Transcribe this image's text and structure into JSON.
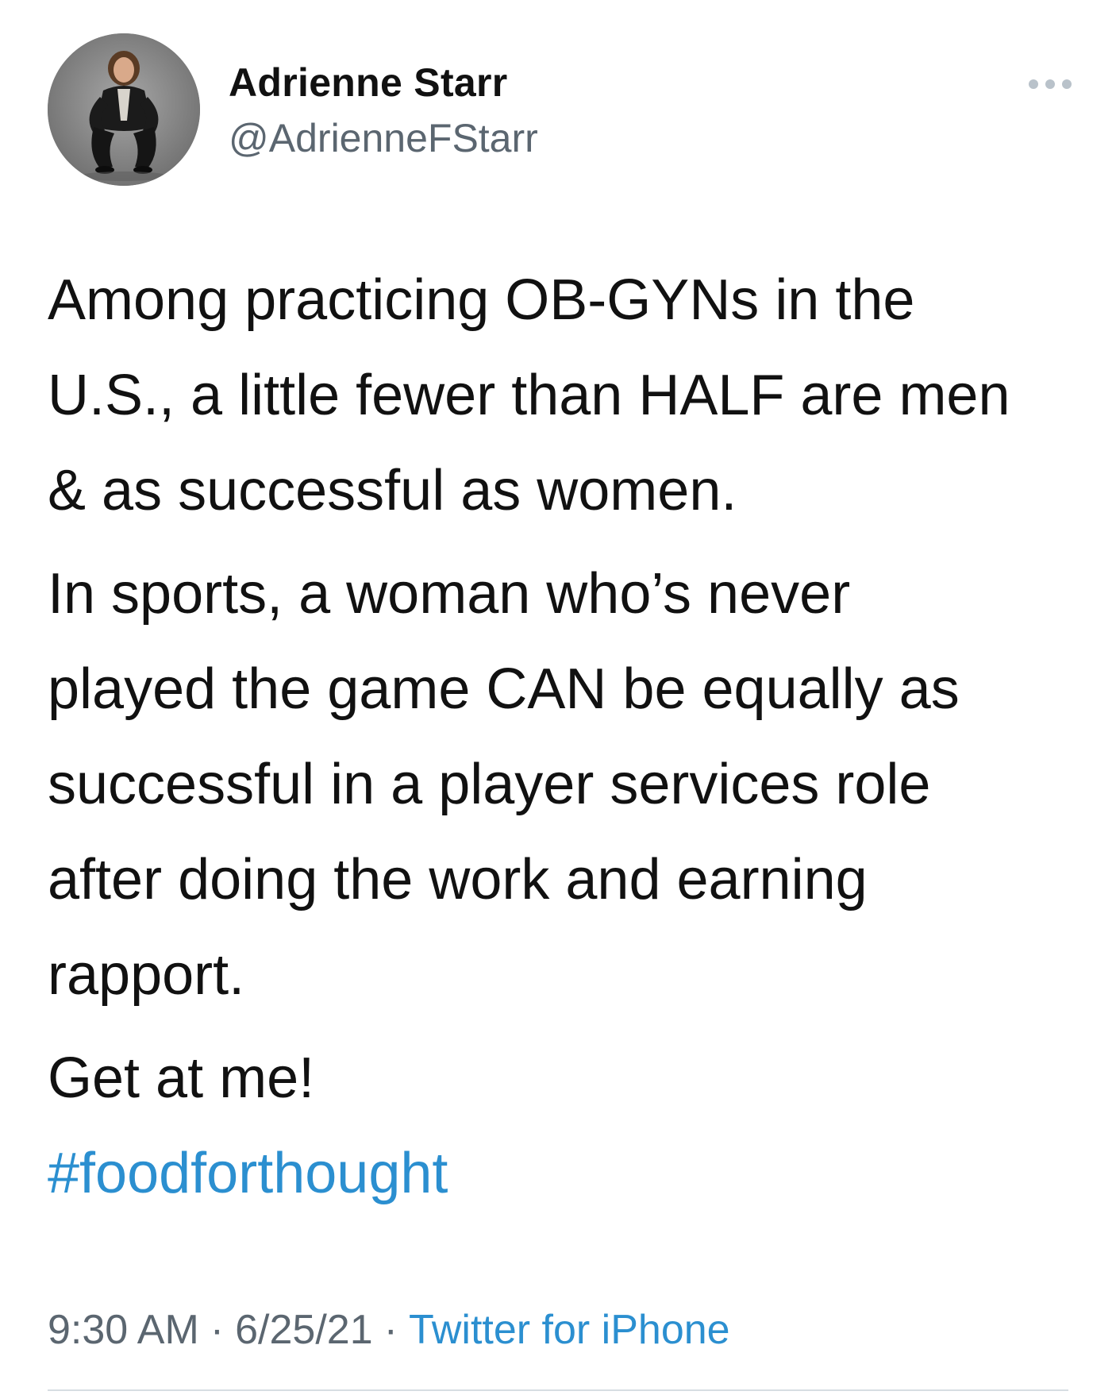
{
  "author": {
    "display_name": "Adrienne Starr",
    "handle": "@AdrienneFStarr"
  },
  "icons": {
    "more": "more-dots-icon",
    "avatar": "profile-photo"
  },
  "tweet": {
    "paragraphs": [
      "Among practicing OB-GYNs in the\nU.S., a little fewer than HALF are men\n& as successful as women.",
      "In sports, a woman who’s never\nplayed the game CAN be equally as\nsuccessful in a player services role\nafter doing the work and earning\nrapport.",
      "Get at me!"
    ],
    "hashtag": "#foodforthought"
  },
  "meta": {
    "time": "9:30 AM",
    "separator": "·",
    "date": "6/25/21",
    "source": "Twitter for iPhone"
  },
  "colors": {
    "link": "#2b8fd0",
    "secondary_text": "#5b6670",
    "text": "#111111"
  }
}
